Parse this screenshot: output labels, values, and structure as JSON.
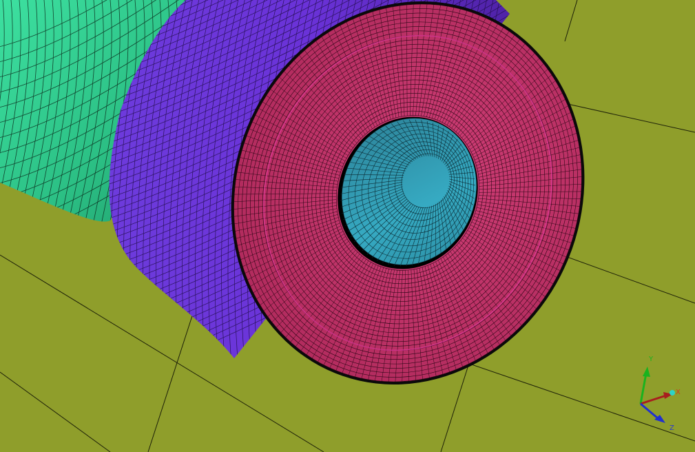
{
  "viewport": {
    "background_color": "#8f9e2b",
    "grid_line_color": "#1c1f08"
  },
  "model": {
    "outer_tube_color": "#2fd08e",
    "sleeve_color": "#6a32d8",
    "ring_face_color": "#c8336a",
    "bore_color": "#2a9ab0",
    "mesh_line_color": "#111111"
  },
  "axis_triad": {
    "y_label": "Y",
    "x_label": "X",
    "z_label": "Z",
    "y_color": "#19b31e",
    "x_color": "#a81e1e",
    "z_color": "#2030d0",
    "x_label_color": "#d23a1a",
    "y_label_color": "#19b31e",
    "z_label_color": "#2a3ad0"
  }
}
